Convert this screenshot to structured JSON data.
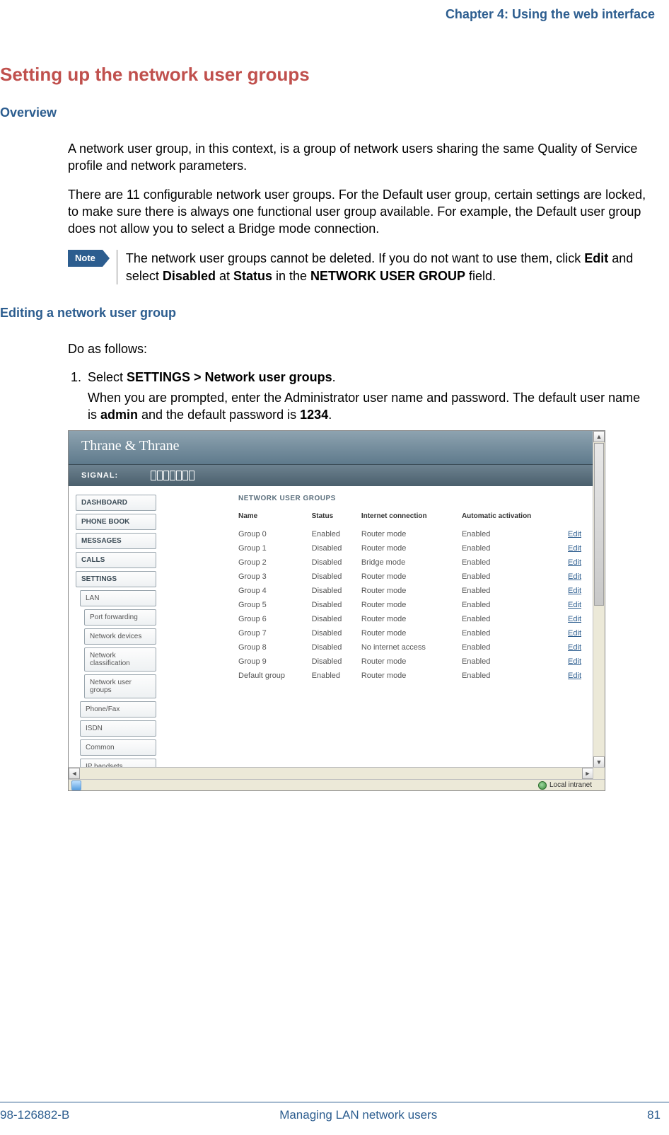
{
  "running_header": "Chapter 4: Using the web interface",
  "section_title": "Setting up the network user groups",
  "overview": {
    "heading": "Overview",
    "p1": "A network user group, in this context, is a group of network users sharing the same Quality of Service profile and network parameters.",
    "p2": "There are 11 configurable network user groups. For the Default user group, certain settings are locked, to make sure there is always one functional user group available. For example, the Default user group does not allow you to select a Bridge mode connection."
  },
  "note": {
    "label": "Note",
    "t1": "The network user groups cannot be deleted. If you do not want to use them, click ",
    "b1": "Edit",
    "t2": " and select ",
    "b2": "Disabled",
    "t3": " at ",
    "b3": "Status",
    "t4": " in the ",
    "b4": "NETWORK USER GROUP",
    "t5": " field."
  },
  "edit_heading": "Editing a network user group",
  "do_as": "Do as follows:",
  "step1": {
    "lead": "Select ",
    "bold": "SETTINGS > Network user groups",
    "tail": ".",
    "p_a": "When you are prompted, enter the Administrator user name and password. The default user name is ",
    "p_b": "admin",
    "p_c": " and the default password is ",
    "p_d": "1234",
    "p_e": "."
  },
  "screenshot": {
    "brand": "Thrane & Thrane",
    "signal_label": "SIGNAL:",
    "nav": {
      "dashboard": "DASHBOARD",
      "phone_book": "PHONE BOOK",
      "messages": "MESSAGES",
      "calls": "CALLS",
      "settings": "SETTINGS",
      "lan": "LAN",
      "port_forwarding": "Port forwarding",
      "network_devices": "Network devices",
      "network_classification": "Network classification",
      "network_user_groups": "Network user groups",
      "phone_fax": "Phone/Fax",
      "isdn": "ISDN",
      "common": "Common",
      "ip_handsets": "IP handsets"
    },
    "panel_title": "NETWORK USER GROUPS",
    "columns": {
      "name": "Name",
      "status": "Status",
      "internet": "Internet connection",
      "auto": "Automatic activation",
      "action": "Edit"
    },
    "rows": [
      {
        "name": "Group 0",
        "status": "Enabled",
        "internet": "Router mode",
        "auto": "Enabled"
      },
      {
        "name": "Group 1",
        "status": "Disabled",
        "internet": "Router mode",
        "auto": "Enabled"
      },
      {
        "name": "Group 2",
        "status": "Disabled",
        "internet": "Bridge mode",
        "auto": "Enabled"
      },
      {
        "name": "Group 3",
        "status": "Disabled",
        "internet": "Router mode",
        "auto": "Enabled"
      },
      {
        "name": "Group 4",
        "status": "Disabled",
        "internet": "Router mode",
        "auto": "Enabled"
      },
      {
        "name": "Group 5",
        "status": "Disabled",
        "internet": "Router mode",
        "auto": "Enabled"
      },
      {
        "name": "Group 6",
        "status": "Disabled",
        "internet": "Router mode",
        "auto": "Enabled"
      },
      {
        "name": "Group 7",
        "status": "Disabled",
        "internet": "Router mode",
        "auto": "Enabled"
      },
      {
        "name": "Group 8",
        "status": "Disabled",
        "internet": "No internet access",
        "auto": "Enabled"
      },
      {
        "name": "Group 9",
        "status": "Disabled",
        "internet": "Router mode",
        "auto": "Enabled"
      },
      {
        "name": "Default group",
        "status": "Enabled",
        "internet": "Router mode",
        "auto": "Enabled"
      }
    ],
    "status_bar": {
      "zone": "Local intranet"
    }
  },
  "footer": {
    "doc_id": "98-126882-B",
    "center": "Managing LAN network users",
    "page": "81"
  }
}
